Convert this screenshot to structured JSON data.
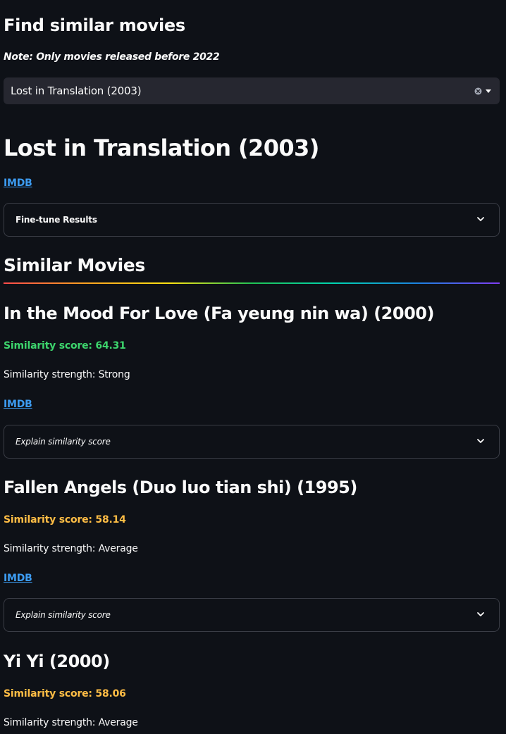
{
  "header": {
    "title": "Find similar movies",
    "note": "Note: Only movies released before 2022"
  },
  "select": {
    "value": "Lost in Translation (2003)",
    "clear_icon": "clear-circle-icon",
    "caret_icon": "caret-down-icon"
  },
  "selected_movie": {
    "title": "Lost in Translation (2003)",
    "link_label": "IMDB"
  },
  "fine_tune": {
    "label": "Fine-tune Results",
    "icon": "chevron-down-icon"
  },
  "similar": {
    "heading": "Similar Movies",
    "colors": {
      "strong": "#3dd56d",
      "average": "#ffbd45",
      "link": "#3d9df3"
    },
    "movies": [
      {
        "title": "In the Mood For Love (Fa yeung nin wa) (2000)",
        "score_text": "Similarity score: 64.31",
        "strength_text": "Similarity strength: Strong",
        "link_label": "IMDB",
        "explain_label": "Explain similarity score"
      },
      {
        "title": "Fallen Angels (Duo luo tian shi) (1995)",
        "score_text": "Similarity score: 58.14",
        "strength_text": "Similarity strength: Average",
        "link_label": "IMDB",
        "explain_label": "Explain similarity score"
      },
      {
        "title": "Yi Yi (2000)",
        "score_text": "Similarity score: 58.06",
        "strength_text": "Similarity strength: Average"
      }
    ]
  }
}
